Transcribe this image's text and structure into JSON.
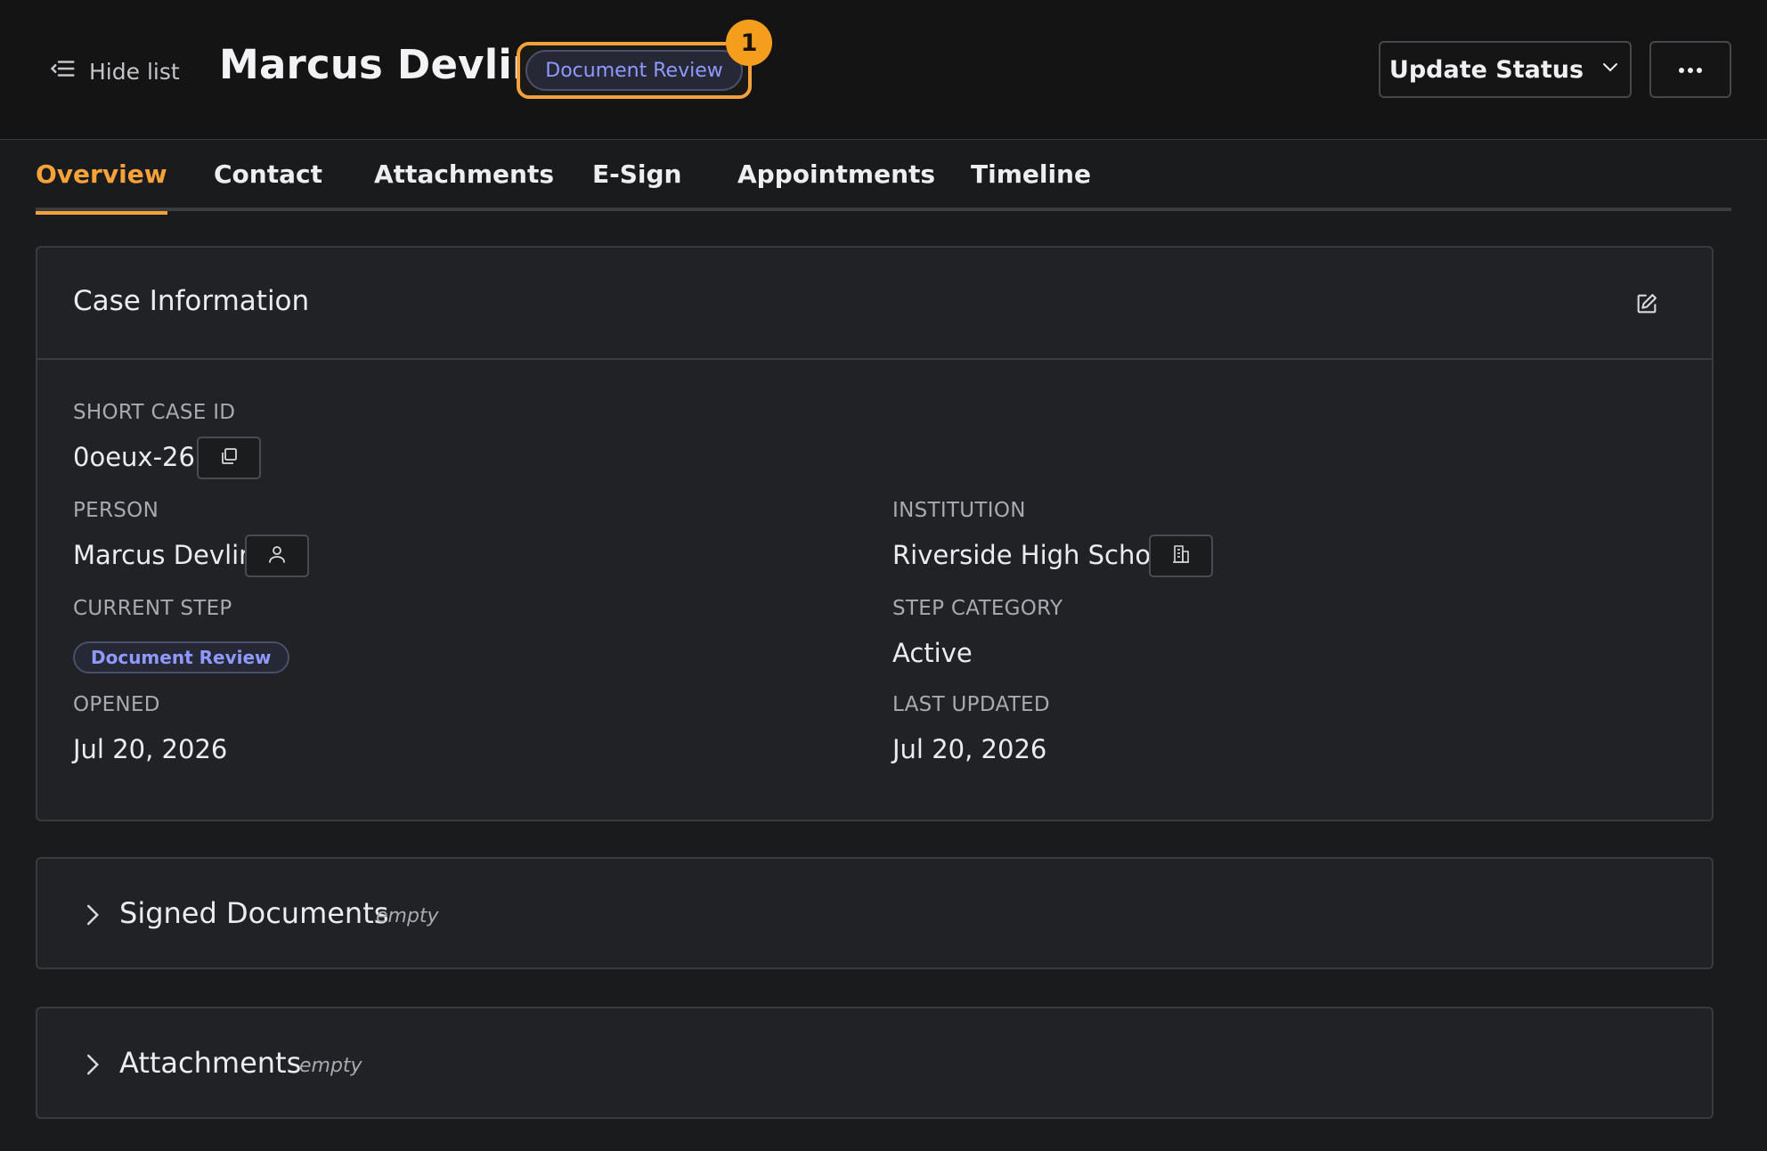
{
  "header": {
    "hide_list_label": "Hide list",
    "title": "Marcus Devlin",
    "status_pill": "Document Review",
    "badge_count": "1",
    "update_status_label": "Update Status"
  },
  "tabs": [
    {
      "label": "Overview",
      "active": true
    },
    {
      "label": "Contact",
      "active": false
    },
    {
      "label": "Attachments",
      "active": false
    },
    {
      "label": "E-Sign",
      "active": false
    },
    {
      "label": "Appointments",
      "active": false
    },
    {
      "label": "Timeline",
      "active": false
    }
  ],
  "case_info": {
    "title": "Case Information",
    "short_case_id_label": "SHORT CASE ID",
    "short_case_id": "0oeux-26",
    "person_label": "PERSON",
    "person": "Marcus Devlin",
    "institution_label": "INSTITUTION",
    "institution": "Riverside High School",
    "current_step_label": "CURRENT STEP",
    "current_step": "Document Review",
    "step_category_label": "STEP CATEGORY",
    "step_category": "Active",
    "opened_label": "OPENED",
    "opened": "Jul 20, 2026",
    "last_updated_label": "LAST UPDATED",
    "last_updated": "Jul 20, 2026"
  },
  "sections": [
    {
      "title": "Signed Documents",
      "empty_label": "empty"
    },
    {
      "title": "Attachments",
      "empty_label": "empty"
    }
  ],
  "colors": {
    "accent": "#f5a23a",
    "status_text": "#8f99ff",
    "badge": "#f59e1d",
    "background": "#1a1b1d"
  },
  "icons": {
    "hide_list": "list-collapse-icon",
    "dropdown": "chevron-down-icon",
    "more": "ellipsis-icon",
    "edit": "edit-icon",
    "copy": "copy-icon",
    "person": "user-icon",
    "institution": "building-icon",
    "expand": "chevron-right-icon"
  }
}
